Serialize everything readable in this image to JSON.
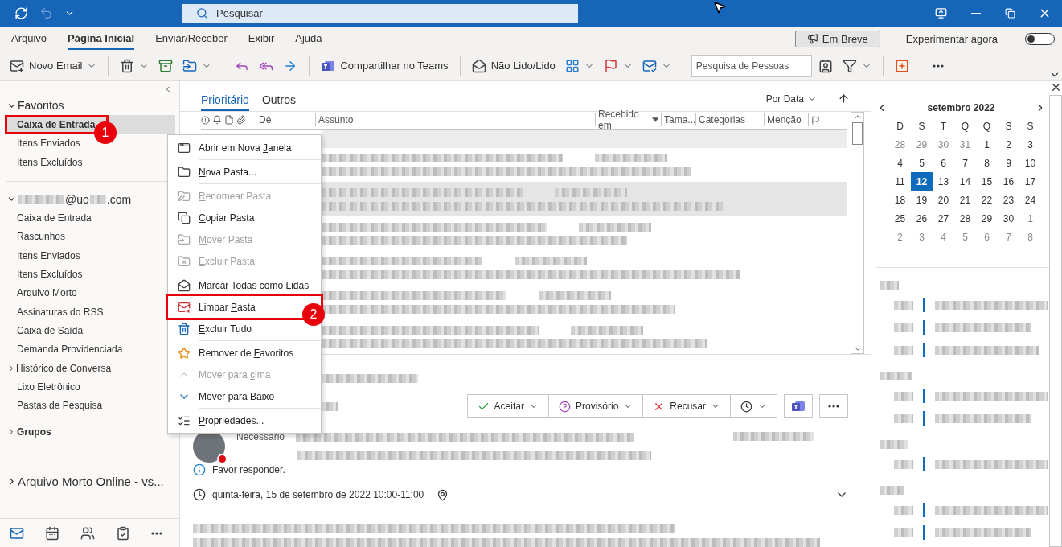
{
  "title_bar": {
    "search_placeholder": "Pesquisar"
  },
  "menu_tabs": [
    {
      "label": "Arquivo",
      "selected": false
    },
    {
      "label": "Página Inicial",
      "selected": true
    },
    {
      "label": "Enviar/Receber",
      "selected": false
    },
    {
      "label": "Exibir",
      "selected": false
    },
    {
      "label": "Ajuda",
      "selected": false
    }
  ],
  "coming_soon": {
    "label": "Em Breve"
  },
  "try_now": {
    "label": "Experimentar agora",
    "on": false
  },
  "ribbon": [
    {
      "kind": "button",
      "label": "Novo Email",
      "dropdown": true
    },
    {
      "kind": "separator"
    },
    {
      "kind": "icon",
      "dropdown": true
    },
    {
      "kind": "icon",
      "dropdown": false
    },
    {
      "kind": "icon",
      "dropdown": true
    },
    {
      "kind": "separator"
    },
    {
      "kind": "icon",
      "dropdown": false
    },
    {
      "kind": "icon",
      "dropdown": false
    },
    {
      "kind": "icon",
      "dropdown": false
    },
    {
      "kind": "separator"
    },
    {
      "kind": "button",
      "label": "Compartilhar no Teams",
      "dropdown": false
    },
    {
      "kind": "separator"
    },
    {
      "kind": "button",
      "label": "Não Lido/Lido",
      "dropdown": false
    },
    {
      "kind": "icon",
      "dropdown": true
    },
    {
      "kind": "icon",
      "dropdown": true
    },
    {
      "kind": "icon",
      "dropdown": true
    },
    {
      "kind": "separator"
    },
    {
      "kind": "search",
      "placeholder": "Pesquisa de Pessoas"
    },
    {
      "kind": "icon",
      "dropdown": false
    },
    {
      "kind": "icon",
      "dropdown": true
    },
    {
      "kind": "separator"
    },
    {
      "kind": "icon",
      "dropdown": false
    },
    {
      "kind": "separator"
    },
    {
      "kind": "icon",
      "dropdown": false
    }
  ],
  "folder_pane": {
    "favorites": {
      "label": "Favoritos",
      "expanded": true,
      "items": [
        {
          "label": "Caixa de Entrada",
          "selected": true,
          "callout": "1"
        },
        {
          "label": "Itens Enviados",
          "selected": false
        },
        {
          "label": "Itens Excluídos",
          "selected": false
        }
      ]
    },
    "account": {
      "label_parts": [
        "@uo",
        ".com"
      ],
      "expanded": true,
      "items": [
        {
          "label": "Caixa de Entrada",
          "selected": false,
          "expandable": false
        },
        {
          "label": "Rascunhos",
          "selected": false,
          "expandable": false
        },
        {
          "label": "Itens Enviados",
          "selected": false,
          "expandable": false
        },
        {
          "label": "Itens Excluídos",
          "selected": false,
          "expandable": false
        },
        {
          "label": "Arquivo Morto",
          "selected": false,
          "expandable": false
        },
        {
          "label": "Assinaturas do RSS",
          "selected": false,
          "expandable": false
        },
        {
          "label": "Caixa de Saída",
          "selected": false,
          "expandable": false
        },
        {
          "label": "Demanda Providenciada",
          "selected": false,
          "expandable": false
        },
        {
          "label": "Histórico de Conversa",
          "selected": false,
          "expandable": true
        },
        {
          "label": "Lixo Eletrônico",
          "selected": false,
          "expandable": false
        },
        {
          "label": "Pastas de Pesquisa",
          "selected": false,
          "expandable": false
        }
      ]
    },
    "groups": {
      "label": "Grupos",
      "expanded": false
    },
    "archive": {
      "label": "Arquivo Morto Online - vs...",
      "expanded": false
    }
  },
  "message_list": {
    "tabs": [
      {
        "label": "Prioritário",
        "selected": true
      },
      {
        "label": "Outros",
        "selected": false
      }
    ],
    "sort_label": "Por Data",
    "columns": [
      {
        "label": "De",
        "sorted": false
      },
      {
        "label": "Assunto",
        "sorted": false
      },
      {
        "label": "Recebido em",
        "sorted": true
      },
      {
        "label": "Tama...",
        "sorted": false
      },
      {
        "label": "Categorias",
        "sorted": false
      },
      {
        "label": "Menção",
        "sorted": false
      }
    ],
    "rows": [
      {
        "selected": false
      },
      {
        "selected": true
      },
      {
        "selected": false
      },
      {
        "selected": false
      },
      {
        "selected": false
      },
      {
        "selected": false
      }
    ]
  },
  "reading_pane": {
    "buttons": [
      {
        "kind": "accept",
        "label": "Aceitar"
      },
      {
        "kind": "tentative",
        "label": "Provisório"
      },
      {
        "kind": "decline",
        "label": "Recusar"
      }
    ],
    "attendee_label": "Necessário",
    "info": "Favor responder.",
    "when": "quinta-feira, 15 de setembro de 2022 10:00-11:00"
  },
  "calendar": {
    "month": "setembro 2022",
    "weekdays": [
      "D",
      "S",
      "T",
      "Q",
      "Q",
      "S",
      "S"
    ],
    "weeks": [
      [
        {
          "day": "28",
          "other": true,
          "selected": false
        },
        {
          "day": "29",
          "other": true,
          "selected": false
        },
        {
          "day": "30",
          "other": true,
          "selected": false
        },
        {
          "day": "31",
          "other": true,
          "selected": false
        },
        {
          "day": "1",
          "other": false,
          "selected": false
        },
        {
          "day": "2",
          "other": false,
          "selected": false
        },
        {
          "day": "3",
          "other": false,
          "selected": false
        }
      ],
      [
        {
          "day": "4",
          "other": false,
          "selected": false
        },
        {
          "day": "5",
          "other": false,
          "selected": false
        },
        {
          "day": "6",
          "other": false,
          "selected": false
        },
        {
          "day": "7",
          "other": false,
          "selected": false
        },
        {
          "day": "8",
          "other": false,
          "selected": false
        },
        {
          "day": "9",
          "other": false,
          "selected": false
        },
        {
          "day": "10",
          "other": false,
          "selected": false
        }
      ],
      [
        {
          "day": "11",
          "other": false,
          "selected": false
        },
        {
          "day": "12",
          "other": false,
          "selected": true
        },
        {
          "day": "13",
          "other": false,
          "selected": false
        },
        {
          "day": "14",
          "other": false,
          "selected": false
        },
        {
          "day": "15",
          "other": false,
          "selected": false
        },
        {
          "day": "16",
          "other": false,
          "selected": false
        },
        {
          "day": "17",
          "other": false,
          "selected": false
        }
      ],
      [
        {
          "day": "18",
          "other": false,
          "selected": false
        },
        {
          "day": "19",
          "other": false,
          "selected": false
        },
        {
          "day": "20",
          "other": false,
          "selected": false
        },
        {
          "day": "21",
          "other": false,
          "selected": false
        },
        {
          "day": "22",
          "other": false,
          "selected": false
        },
        {
          "day": "23",
          "other": false,
          "selected": false
        },
        {
          "day": "24",
          "other": false,
          "selected": false
        }
      ],
      [
        {
          "day": "25",
          "other": false,
          "selected": false
        },
        {
          "day": "26",
          "other": false,
          "selected": false
        },
        {
          "day": "27",
          "other": false,
          "selected": false
        },
        {
          "day": "28",
          "other": false,
          "selected": false
        },
        {
          "day": "29",
          "other": false,
          "selected": false
        },
        {
          "day": "30",
          "other": false,
          "selected": false
        },
        {
          "day": "1",
          "other": true,
          "selected": false
        }
      ],
      [
        {
          "day": "2",
          "other": true,
          "selected": false
        },
        {
          "day": "3",
          "other": true,
          "selected": false
        },
        {
          "day": "4",
          "other": true,
          "selected": false
        },
        {
          "day": "5",
          "other": true,
          "selected": false
        },
        {
          "day": "6",
          "other": true,
          "selected": false
        },
        {
          "day": "7",
          "other": true,
          "selected": false
        },
        {
          "day": "8",
          "other": true,
          "selected": false
        }
      ]
    ]
  },
  "context_menu": [
    {
      "kind": "item",
      "pre": "Abrir em Nova ",
      "key": "J",
      "post": "anela",
      "disabled": false
    },
    {
      "kind": "separator"
    },
    {
      "kind": "item",
      "key": "N",
      "post": "ova Pasta...",
      "disabled": false
    },
    {
      "kind": "separator"
    },
    {
      "kind": "item",
      "key": "R",
      "post": "enomear Pasta",
      "disabled": true
    },
    {
      "kind": "item",
      "key": "C",
      "post": "opiar Pasta",
      "disabled": false
    },
    {
      "kind": "item",
      "key": "M",
      "post": "over Pasta",
      "disabled": true
    },
    {
      "kind": "item",
      "key": "E",
      "post": "xcluir Pasta",
      "disabled": true
    },
    {
      "kind": "separator"
    },
    {
      "kind": "item",
      "pre": "Marcar Todas como L",
      "key": "i",
      "post": "das",
      "disabled": false
    },
    {
      "kind": "item",
      "pre": "Limpar ",
      "key": "P",
      "post": "asta",
      "disabled": false,
      "callout": "2"
    },
    {
      "kind": "item",
      "key": "E",
      "post": "xcluir Tudo",
      "disabled": false
    },
    {
      "kind": "separator"
    },
    {
      "kind": "item",
      "pre": "Remover de ",
      "key": "F",
      "post": "avoritos",
      "disabled": false
    },
    {
      "kind": "item",
      "pre": "Mover para ",
      "key": "c",
      "post": "ima",
      "disabled": true
    },
    {
      "kind": "item",
      "pre": "Mover para ",
      "key": "B",
      "post": "aixo",
      "disabled": false
    },
    {
      "kind": "separator"
    },
    {
      "kind": "item",
      "key": "P",
      "post": "ropriedades...",
      "disabled": false
    }
  ]
}
